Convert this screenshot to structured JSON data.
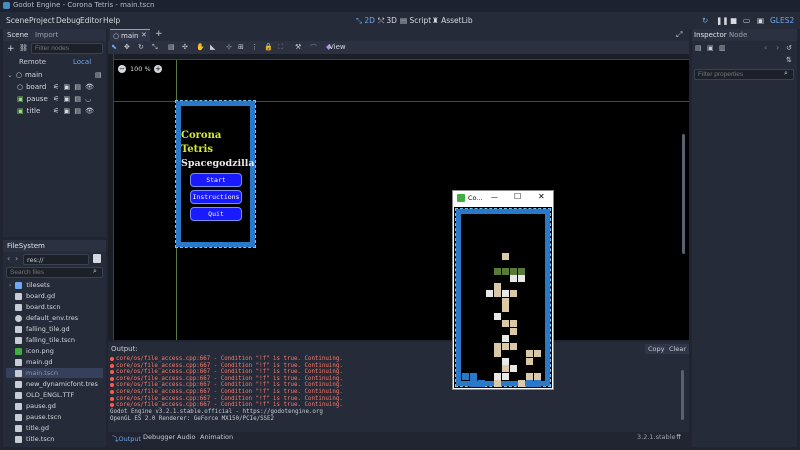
{
  "window_title": "Godot Engine - Corona Tetris - main.tscn",
  "menu": [
    "Scene",
    "Project",
    "Debug",
    "Editor",
    "Help"
  ],
  "workspaces": [
    "2D",
    "3D",
    "Script",
    "AssetLib"
  ],
  "renderer": "GLES2",
  "scene_panel": {
    "tabs": [
      "Scene",
      "Import"
    ],
    "filter_placeholder": "Filter nodes",
    "remote": "Remote",
    "local": "Local",
    "nodes": [
      "main",
      "board",
      "pause",
      "title"
    ]
  },
  "filesystem": {
    "tab": "FileSystem",
    "path": "res://",
    "search_placeholder": "Search files",
    "files": [
      "tilesets",
      "board.gd",
      "board.tscn",
      "default_env.tres",
      "falling_tile.gd",
      "falling_tile.tscn",
      "icon.png",
      "main.gd",
      "main.tscn",
      "new_dynamicfont.tres",
      "OLD_ENGL.TTF",
      "pause.gd",
      "pause.tscn",
      "title.gd",
      "title.tscn"
    ]
  },
  "editor": {
    "tab": "main",
    "zoom": "100 %",
    "view_label": "View"
  },
  "game_title": {
    "line1": "Corona",
    "line2": "Tetris",
    "line3": "Spacegodzilla",
    "buttons": [
      "Start",
      "Instructions",
      "Quit"
    ]
  },
  "game_window": {
    "title": "Co...",
    "minimize": "—",
    "maximize": "☐",
    "close": "✕"
  },
  "output": {
    "title": "Output:",
    "copy": "Copy",
    "clear": "Clear",
    "lines": [
      "core/os/file_access.cpp:667 - Condition \"!f\" is true. Continuing.",
      "core/os/file_access.cpp:667 - Condition \"!f\" is true. Continuing.",
      "core/os/file_access.cpp:667 - Condition \"!f\" is true. Continuing.",
      "core/os/file_access.cpp:667 - Condition \"!f\" is true. Continuing.",
      "core/os/file_access.cpp:667 - Condition \"!f\" is true. Continuing.",
      "core/os/file_access.cpp:667 - Condition \"!f\" is true. Continuing.",
      "core/os/file_access.cpp:667 - Condition \"!f\" is true. Continuing.",
      "core/os/file_access.cpp:667 - Condition \"!f\" is true. Continuing."
    ],
    "info_lines": [
      "Godot Engine v3.2.1.stable.official - https://godotengine.org",
      "OpenGL ES 2.0 Renderer: GeForce MX150/PCIe/SSE2"
    ]
  },
  "bottom_tabs": [
    "Output",
    "Debugger",
    "Audio",
    "Animation"
  ],
  "version": "3.2.1.stable",
  "inspector": {
    "tabs": [
      "Inspector",
      "Node"
    ],
    "filter_placeholder": "Filter properties"
  },
  "colors": {
    "accent": "#6ea8f0",
    "error": "#ff7a6b",
    "bg": "#202531"
  }
}
